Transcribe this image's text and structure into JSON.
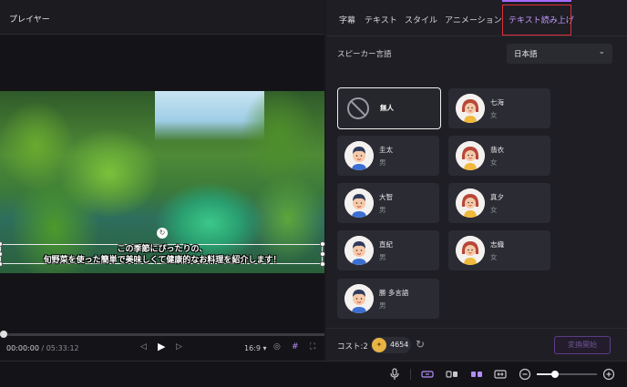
{
  "player": {
    "title": "プレイヤー",
    "caption_line1": "この季節にぴったりの、",
    "caption_line2": "旬野菜を使った簡単で美味しくて健康的なお料理を紹介します！",
    "current_time": "00:00:00",
    "separator": " / ",
    "duration": "05:33:12",
    "aspect_ratio": "16:9",
    "progress_fraction": 0.0
  },
  "panel": {
    "tabs": [
      {
        "label": "字幕"
      },
      {
        "label": "テキスト"
      },
      {
        "label": "スタイル"
      },
      {
        "label": "アニメーション"
      },
      {
        "label": "テキスト読み上げ"
      }
    ],
    "active_tab": "テキスト読み上げ",
    "language_label": "スピーカー言語",
    "language_value": "日本語",
    "speakers": [
      {
        "name": "無人",
        "gender": "",
        "avatar": "none-icon"
      },
      {
        "name": "七海",
        "gender": "女",
        "avatar": "female"
      },
      {
        "name": "圭太",
        "gender": "男",
        "avatar": "male"
      },
      {
        "name": "翡衣",
        "gender": "女",
        "avatar": "female"
      },
      {
        "name": "大智",
        "gender": "男",
        "avatar": "male"
      },
      {
        "name": "真夕",
        "gender": "女",
        "avatar": "female"
      },
      {
        "name": "直紀",
        "gender": "男",
        "avatar": "male"
      },
      {
        "name": "志織",
        "gender": "女",
        "avatar": "female"
      },
      {
        "name": "勝 多言語",
        "gender": "男",
        "avatar": "male"
      }
    ],
    "cost_label": "コスト:2",
    "coin_value": "4654",
    "convert_label": "変換開始"
  },
  "colors": {
    "accent": "#a56bff",
    "highlight_box": "#e0303a",
    "coin": "#e8b445"
  }
}
